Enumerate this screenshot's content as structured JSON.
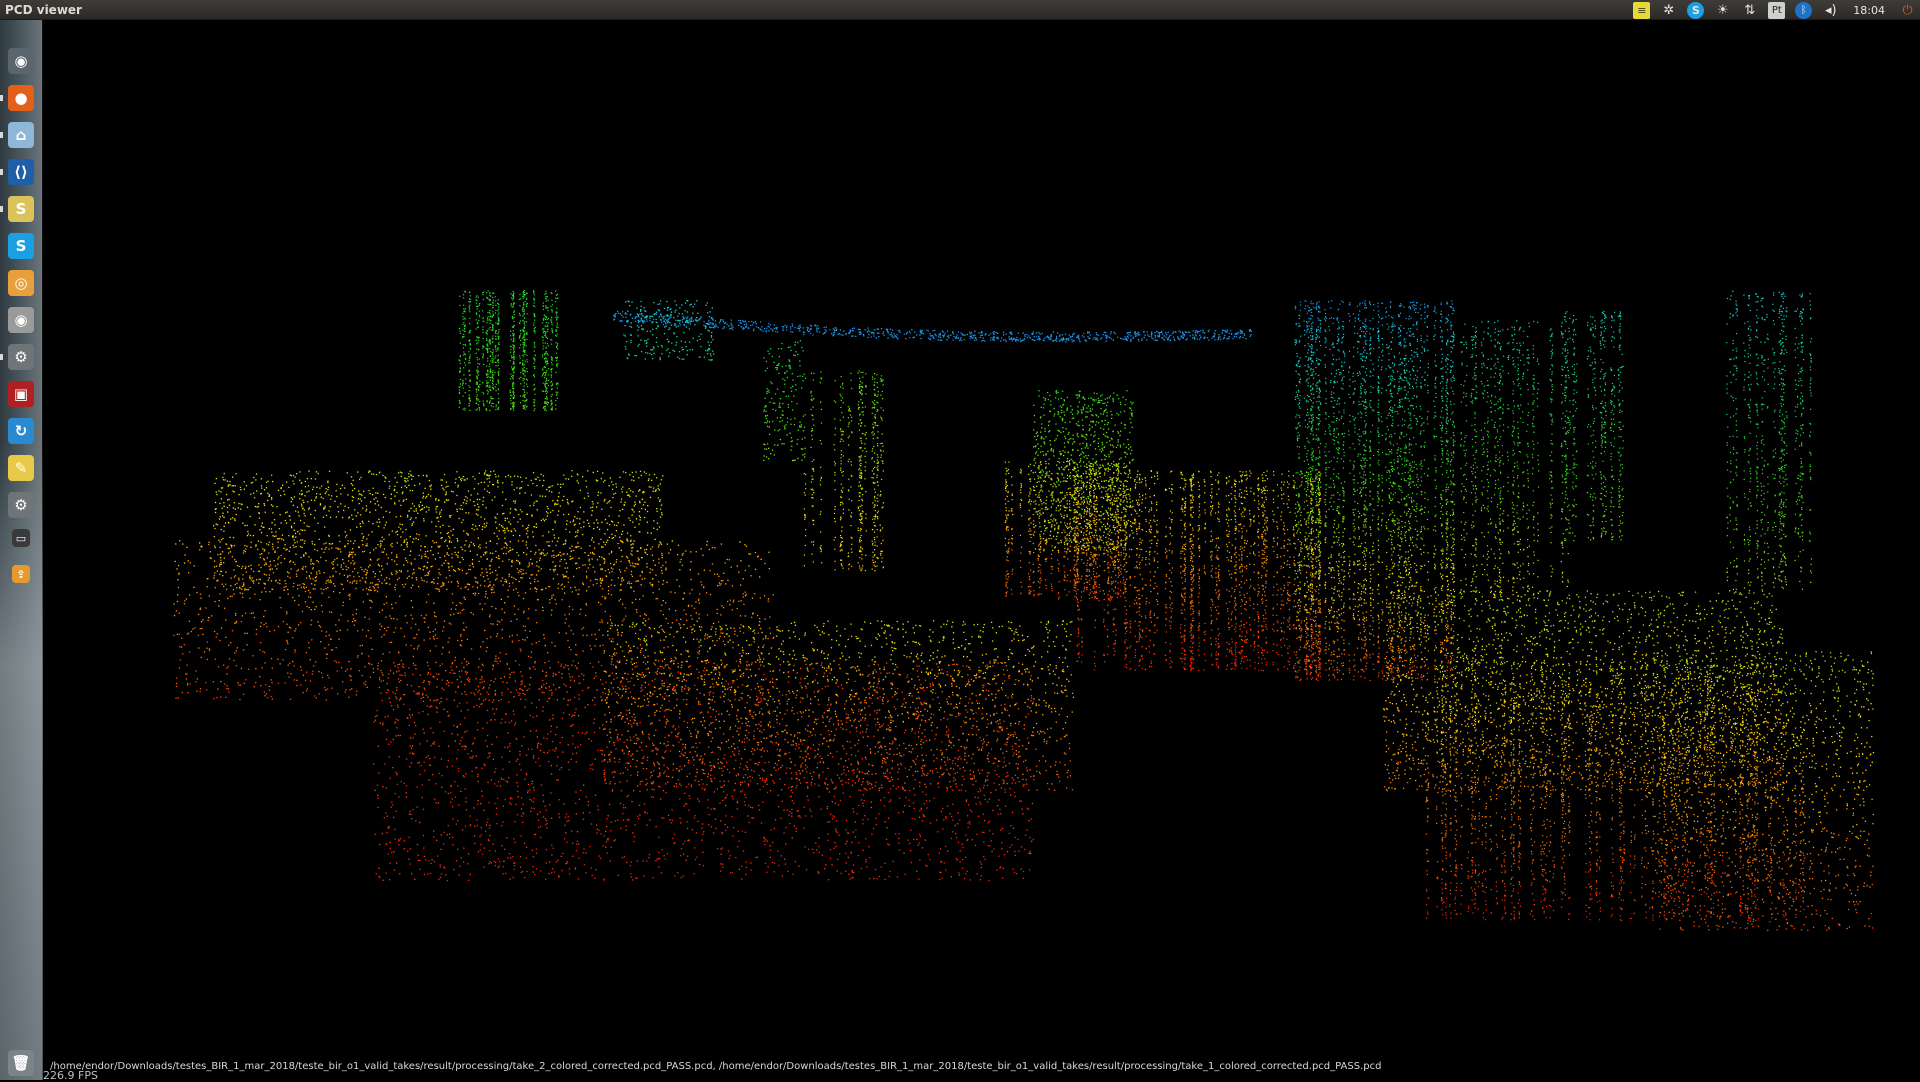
{
  "window": {
    "title": "PCD viewer"
  },
  "tray": {
    "clock": "18:04",
    "icons": [
      "notes-icon",
      "settings-alert-icon",
      "skype-icon",
      "brightness-icon",
      "network-transfer-icon",
      "keyboard-layout-icon",
      "bluetooth-icon",
      "volume-icon",
      "power-icon"
    ],
    "keyboard_label": "Pt"
  },
  "launcher": {
    "items": [
      {
        "name": "dash-icon",
        "glyph": "◉",
        "bg": "#5b6570"
      },
      {
        "name": "firefox-icon",
        "glyph": "●",
        "bg": "#e2601a"
      },
      {
        "name": "files-icon",
        "glyph": "⌂",
        "bg": "#8fb8d8"
      },
      {
        "name": "vscode-icon",
        "glyph": "⟨⟩",
        "bg": "#1e5fa8"
      },
      {
        "name": "slack-icon",
        "glyph": "S",
        "bg": "#d9c35a"
      },
      {
        "name": "skype-icon",
        "glyph": "S",
        "bg": "#1aa0e3"
      },
      {
        "name": "chromium-icon",
        "glyph": "◎",
        "bg": "#e8a13a"
      },
      {
        "name": "eye-app-icon",
        "glyph": "◉",
        "bg": "#9a9a9a"
      },
      {
        "name": "settings-icon",
        "glyph": "⚙",
        "bg": "#6e7478"
      },
      {
        "name": "screen-recorder-icon",
        "glyph": "▣",
        "bg": "#b02020"
      },
      {
        "name": "sync-icon",
        "glyph": "↻",
        "bg": "#2a8ad0"
      },
      {
        "name": "text-editor-icon",
        "glyph": "✎",
        "bg": "#e9c94a"
      },
      {
        "name": "system-settings-icon",
        "glyph": "⚙",
        "bg": "#6e7478"
      },
      {
        "name": "terminal-icon",
        "glyph": "▭",
        "bg": "#3a3a3a"
      },
      {
        "name": "uploader-icon",
        "glyph": "⇪",
        "bg": "#e49a2e"
      },
      {
        "name": "trash-icon",
        "glyph": "🗑",
        "bg": "#7c8488"
      }
    ]
  },
  "viewer": {
    "status_line": "/home/endor/Downloads/testes_BIR_1_mar_2018/teste_bir_o1_valid_takes/result/processing/take_2_colored_corrected.pcd_PASS.pcd, /home/endor/Downloads/testes_BIR_1_mar_2018/teste_bir_o1_valid_takes/result/processing/take_1_colored_corrected.pcd_PASS.pcd",
    "fps": "226.9 FPS"
  }
}
